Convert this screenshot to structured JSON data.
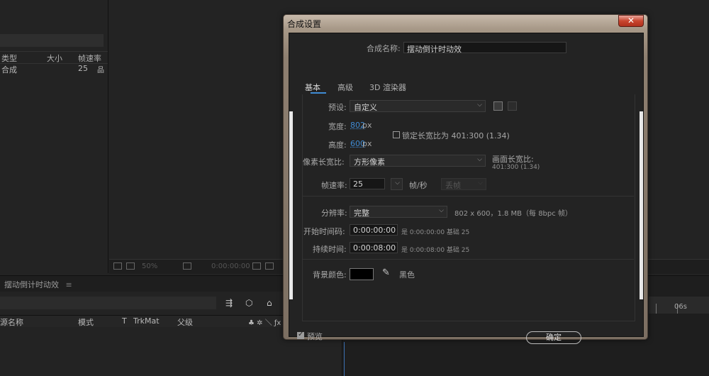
{
  "project": {
    "columns": [
      "类型",
      "大小",
      "帧速率"
    ],
    "row": {
      "type": "合成",
      "fps": "25"
    }
  },
  "viewer": {
    "zoom": "50%",
    "timecode": "0:00:00:00"
  },
  "timeline": {
    "tab_label": "摆动倒计时动效",
    "columns": [
      "源名称",
      "模式",
      "T",
      "TrkMat",
      "父级"
    ],
    "ruler_label": "06s"
  },
  "dialog": {
    "title": "合成设置",
    "close_glyph": "✕",
    "comp_name_label": "合成名称:",
    "comp_name_value": "摆动倒计时动效",
    "tabs": [
      "基本",
      "高级",
      "3D 渲染器"
    ],
    "preset_label": "预设:",
    "preset_value": "自定义",
    "width_label": "宽度:",
    "width_value": "802",
    "height_label": "高度:",
    "height_value": "600",
    "px_unit": "px",
    "lock_aspect_label": "锁定长宽比为 401:300 (1.34)",
    "pixel_aspect_label": "像素长宽比:",
    "pixel_aspect_value": "方形像素",
    "frame_aspect_label": "画面长宽比:",
    "frame_aspect_value": "401:300 (1.34)",
    "fps_label": "帧速率:",
    "fps_value": "25",
    "fps_unit": "帧/秒",
    "drop_frame_value": "丢帧",
    "resolution_label": "分辨率:",
    "resolution_value": "完整",
    "resolution_info": "802 x 600，1.8 MB（每 8bpc 帧）",
    "start_tc_label": "开始时间码:",
    "start_tc_value": "0:00:00:00",
    "start_tc_info": "是 0:00:00:00   基础 25",
    "duration_label": "持续时间:",
    "duration_value": "0:00:08:00",
    "duration_info": "是 0:00:08:00   基础 25",
    "bg_color_label": "背景颜色:",
    "bg_color_name": "黑色",
    "bg_color_hex": "#000000",
    "preview_label": "预览",
    "ok_label": "确定"
  },
  "accent_color": "#3f8bd4"
}
